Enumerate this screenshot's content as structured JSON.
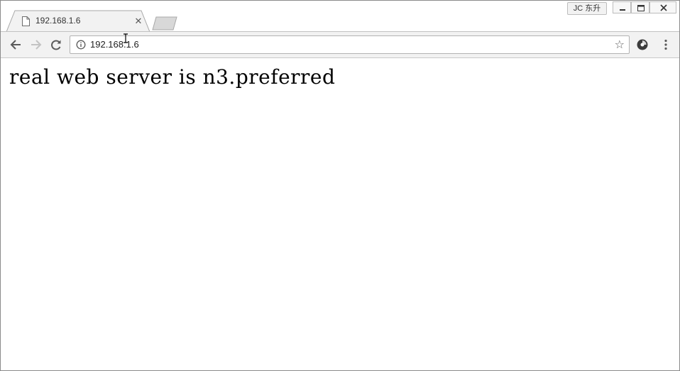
{
  "browser": {
    "tabs": [
      {
        "title": "192.168.1.6",
        "active": true
      }
    ],
    "profile_label": "JC 东升",
    "address_bar": {
      "url": "192.168.1.6"
    },
    "icons": {
      "back": "back-arrow-icon",
      "forward": "forward-arrow-icon",
      "reload": "reload-icon",
      "info": "info-icon",
      "bookmark": "star-icon",
      "extension": "extension-icon",
      "menu": "kebab-menu-icon"
    }
  },
  "page": {
    "body_text": "real web server is n3.preferred"
  },
  "colors": {
    "toolbar_bg": "#f2f2f2",
    "page_bg": "#ffffff",
    "text": "#000000"
  }
}
